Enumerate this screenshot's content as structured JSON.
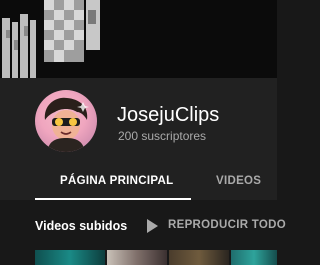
{
  "channel": {
    "name": "JosejuClips",
    "subscribers": "200 suscriptores"
  },
  "tabs": [
    {
      "label": "PÁGINA PRINCIPAL",
      "active": true
    },
    {
      "label": "VIDEOS",
      "active": false
    }
  ],
  "section": {
    "title": "Videos subidos",
    "play_all_label": "REPRODUCIR TODO"
  },
  "colors": {
    "background": "#181818",
    "header": "#212121",
    "primary_text": "#ffffff",
    "secondary_text": "#aaaaaa"
  },
  "icons": {
    "play_all": "play-icon"
  }
}
